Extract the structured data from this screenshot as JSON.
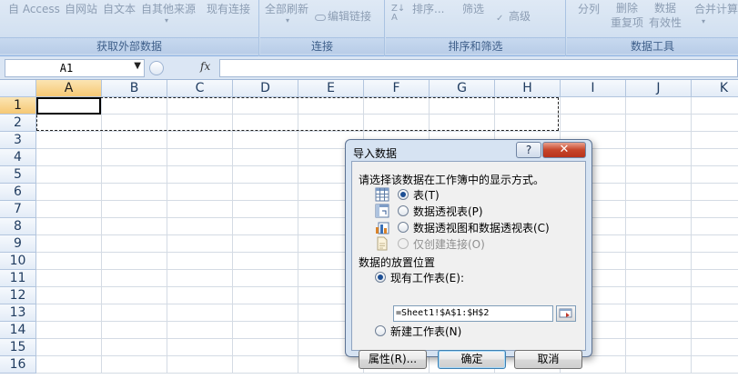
{
  "ribbon": {
    "groups": [
      {
        "label": "获取外部数据",
        "items": [
          "自 Access",
          "自网站",
          "自文本",
          "自其他来源"
        ]
      },
      {
        "label": "",
        "items": [
          "现有连接"
        ]
      },
      {
        "label": "连接",
        "items": [
          "全部刷新",
          "编辑链接"
        ]
      },
      {
        "label": "排序和筛选",
        "items": [
          "排序...",
          "筛选",
          "高级"
        ]
      },
      {
        "label": "数据工具",
        "items": [
          "分列",
          "删除\n重复项",
          "数据\n有效性",
          "合并计算"
        ]
      }
    ]
  },
  "formula_bar": {
    "name_box": "A1",
    "fx_label": "fx",
    "formula": ""
  },
  "sheet": {
    "columns": [
      "A",
      "B",
      "C",
      "D",
      "E",
      "F",
      "G",
      "H",
      "I",
      "J",
      "K"
    ],
    "rows": [
      "1",
      "2",
      "3",
      "4",
      "5",
      "6",
      "7",
      "8",
      "9",
      "10",
      "11",
      "12",
      "13",
      "14",
      "15",
      "16"
    ],
    "selected_column": "A",
    "selected_row": "1"
  },
  "dialog": {
    "title": "导入数据",
    "help_label": "?",
    "close_label": "✕",
    "prompt": "请选择该数据在工作簿中的显示方式。",
    "view_options": [
      {
        "label": "表(T)",
        "selected": true,
        "enabled": true,
        "icon": "table-icon"
      },
      {
        "label": "数据透视表(P)",
        "selected": false,
        "enabled": true,
        "icon": "pivot-table-icon"
      },
      {
        "label": "数据透视图和数据透视表(C)",
        "selected": false,
        "enabled": true,
        "icon": "pivot-chart-icon"
      },
      {
        "label": "仅创建连接(O)",
        "selected": false,
        "enabled": false,
        "icon": "connection-icon"
      }
    ],
    "placement_label": "数据的放置位置",
    "existing_sheet_label": "现有工作表(E):",
    "existing_sheet_selected": true,
    "range_value": "=Sheet1!$A$1:$H$2",
    "new_sheet_label": "新建工作表(N)",
    "new_sheet_selected": false,
    "buttons": {
      "properties": "属性(R)...",
      "ok": "确定",
      "cancel": "取消"
    }
  }
}
